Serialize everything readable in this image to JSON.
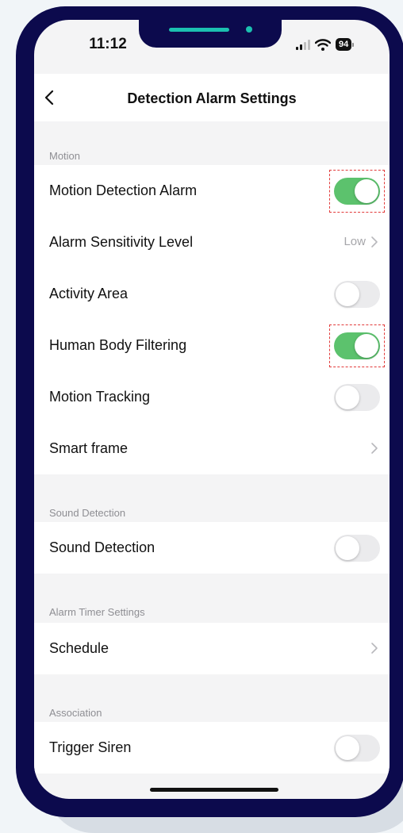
{
  "status_bar": {
    "time": "11:12",
    "battery": "94"
  },
  "header": {
    "title": "Detection Alarm Settings"
  },
  "sections": {
    "motion": {
      "label": "Motion",
      "motion_detection_alarm": {
        "label": "Motion Detection Alarm",
        "on": true,
        "highlighted": true
      },
      "alarm_sensitivity_level": {
        "label": "Alarm Sensitivity Level",
        "value": "Low"
      },
      "activity_area": {
        "label": "Activity Area",
        "on": false
      },
      "human_body_filtering": {
        "label": "Human Body Filtering",
        "on": true,
        "highlighted": true
      },
      "motion_tracking": {
        "label": "Motion Tracking",
        "on": false
      },
      "smart_frame": {
        "label": "Smart frame"
      }
    },
    "sound": {
      "label": "Sound Detection",
      "sound_detection": {
        "label": "Sound Detection",
        "on": false
      }
    },
    "timer": {
      "label": "Alarm Timer Settings",
      "schedule": {
        "label": "Schedule"
      }
    },
    "association": {
      "label": "Association",
      "trigger_siren": {
        "label": "Trigger Siren",
        "on": false
      }
    }
  },
  "colors": {
    "toggle_on": "#5cc26d",
    "toggle_off": "#ebebed",
    "highlight_box": "#e23b3b",
    "phone_frame": "#0c0a4d",
    "notch_accent": "#1bc0b0"
  }
}
